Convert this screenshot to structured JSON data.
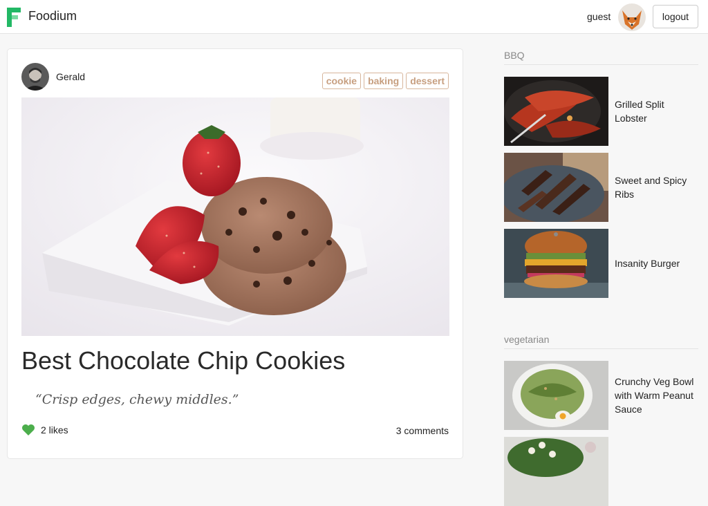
{
  "header": {
    "brand": "Foodium",
    "logo_icon": "foodium-logo-icon",
    "brand_color": "#1fa65a",
    "username": "guest",
    "logout_label": "logout"
  },
  "post": {
    "author": "Gerald",
    "tags": [
      "cookie",
      "baking",
      "dessert"
    ],
    "title": "Best Chocolate Chip Cookies",
    "quote": "“Crisp edges, chewy middles.”",
    "likes": "2 likes",
    "comments": "3 comments",
    "like_color": "#4cae4c",
    "tag_color": "#c79f80"
  },
  "sidebar": {
    "sections": [
      {
        "heading": "BBQ",
        "items": [
          {
            "title": "Grilled Split Lobster"
          },
          {
            "title": "Sweet and Spicy Ribs"
          },
          {
            "title": "Insanity Burger"
          }
        ]
      },
      {
        "heading": "vegetarian",
        "items": [
          {
            "title": "Crunchy Veg Bowl with Warm Peanut Sauce"
          },
          {
            "title": ""
          }
        ]
      }
    ]
  }
}
